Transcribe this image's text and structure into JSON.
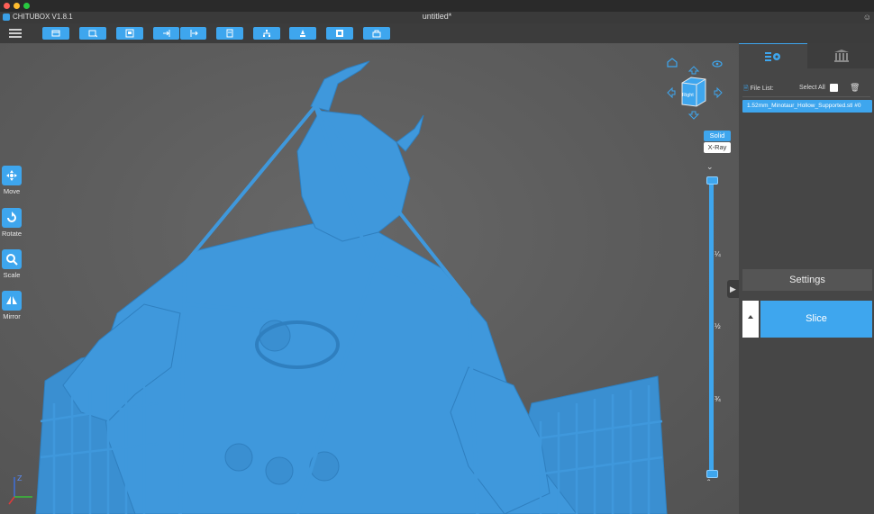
{
  "app": {
    "name": "CHITUBOX V1.8.1",
    "document_title": "untitled*"
  },
  "window_controls": [
    "close",
    "minimize",
    "maximize"
  ],
  "toolbar": {
    "buttons": [
      {
        "name": "open-file-icon"
      },
      {
        "name": "open-recent-icon"
      },
      {
        "name": "save-icon"
      },
      {
        "name": "import-icon"
      },
      {
        "name": "export-icon"
      },
      {
        "name": "report-icon"
      },
      {
        "name": "network-icon"
      },
      {
        "name": "support-icon"
      },
      {
        "name": "hollow-icon"
      },
      {
        "name": "print-icon"
      }
    ]
  },
  "left_tools": [
    {
      "label": "Move",
      "icon": "move-icon"
    },
    {
      "label": "Rotate",
      "icon": "rotate-icon"
    },
    {
      "label": "Scale",
      "icon": "scale-icon"
    },
    {
      "label": "Mirror",
      "icon": "mirror-icon"
    }
  ],
  "view_cube": {
    "face_label": "Right"
  },
  "view_modes": {
    "solid": "Solid",
    "xray": "X-Ray",
    "active": "Solid"
  },
  "layer_slider": {
    "quarter": "¼",
    "half": "½",
    "three_quarter": "¾"
  },
  "right_panel": {
    "file_list_label": "File List:",
    "select_all_label": "Select All",
    "files": [
      "1.52mm_Minotaur_Hollow_Supported.stl #0"
    ],
    "settings_label": "Settings",
    "slice_label": "Slice"
  },
  "colors": {
    "accent": "#3ea6ee",
    "model": "#3f98dc",
    "background": "#5b5b5b",
    "panel": "#464646"
  }
}
